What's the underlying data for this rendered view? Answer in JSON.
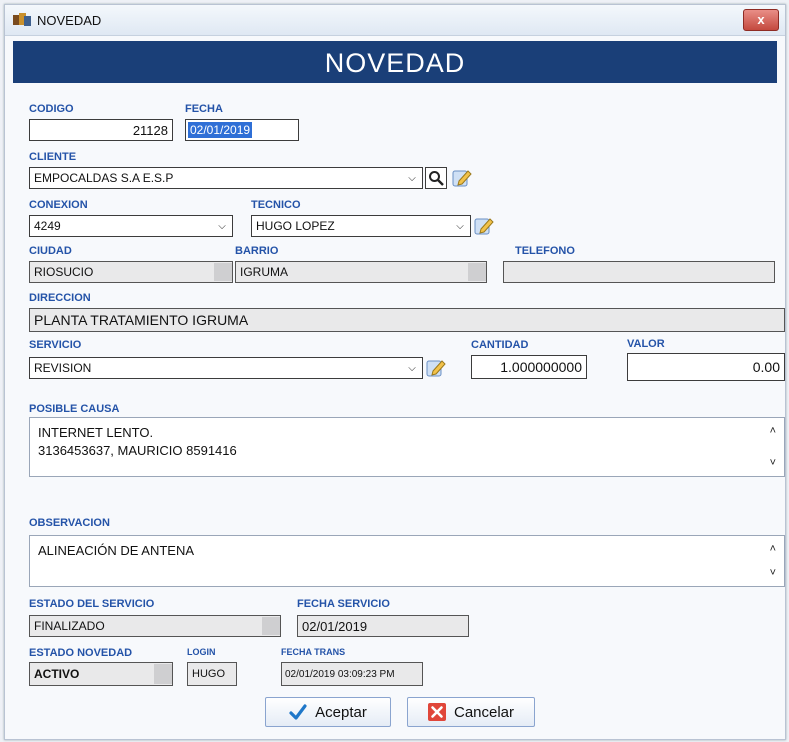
{
  "window": {
    "title": "NOVEDAD",
    "close_glyph": "x"
  },
  "header": {
    "banner": "NOVEDAD"
  },
  "labels": {
    "codigo": "CODIGO",
    "fecha": "FECHA",
    "cliente": "CLIENTE",
    "conexion": "CONEXION",
    "tecnico": "TECNICO",
    "ciudad": "CIUDAD",
    "barrio": "BARRIO",
    "telefono": "TELEFONO",
    "direccion": "DIRECCION",
    "servicio": "SERVICIO",
    "cantidad": "CANTIDAD",
    "valor": "VALOR",
    "posible_causa": "POSIBLE CAUSA",
    "observacion": "OBSERVACION",
    "estado_servicio": "ESTADO DEL SERVICIO",
    "fecha_servicio": "FECHA SERVICIO",
    "estado_novedad": "ESTADO NOVEDAD",
    "login": "LOGIN",
    "fecha_trans": "FECHA TRANS"
  },
  "fields": {
    "codigo": "21128",
    "fecha": "02/01/2019",
    "cliente": "EMPOCALDAS S.A E.S.P",
    "conexion": "4249",
    "tecnico": "HUGO LOPEZ",
    "ciudad": "RIOSUCIO",
    "barrio": "IGRUMA",
    "telefono": "",
    "direccion": "PLANTA TRATAMIENTO IGRUMA",
    "servicio": "REVISION",
    "cantidad": "1.000000000",
    "valor": "0.00",
    "posible_causa_line1": "INTERNET LENTO.",
    "posible_causa_line2": "3136453637, MAURICIO    8591416",
    "observacion": "ALINEACIÓN DE ANTENA",
    "estado_servicio": "FINALIZADO",
    "fecha_servicio": "02/01/2019",
    "estado_novedad": "ACTIVO",
    "login": "HUGO",
    "fecha_trans": "02/01/2019 03:09:23 PM"
  },
  "buttons": {
    "accept": "Aceptar",
    "cancel": "Cancelar"
  },
  "icons": {
    "app": "database-icon",
    "search": "search-icon",
    "edit": "edit-pencil-icon",
    "accept": "checkmark-icon",
    "cancel": "cancel-x-icon"
  },
  "colors": {
    "banner": "#1a3f78",
    "label": "#2453a8",
    "selection": "#2f6fd6"
  }
}
